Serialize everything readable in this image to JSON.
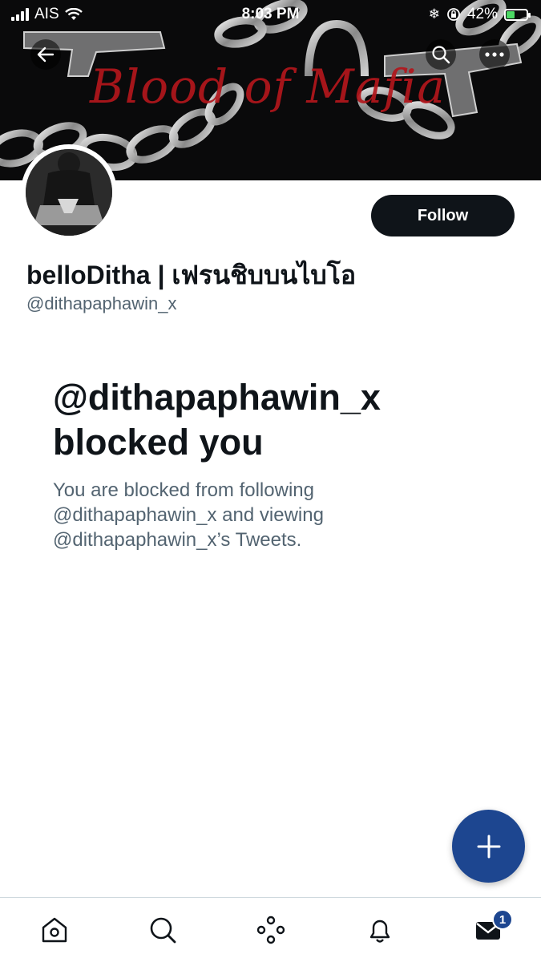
{
  "status_bar": {
    "carrier": "AIS",
    "time": "8:03 PM",
    "battery": "42%",
    "battery_level": 0.42
  },
  "top_nav": {
    "back_icon": "arrow-left-icon",
    "search_icon": "search-icon",
    "more_icon": "more-horizontal-icon"
  },
  "banner": {
    "text": "Blood of Mafia"
  },
  "profile": {
    "display_name": "belloDitha | เฟรนชิบบนไบโอ",
    "handle": "@dithapaphawin_x",
    "follow_label": "Follow"
  },
  "blocked": {
    "title_line1": "@dithapaphawin_x",
    "title_line2": "blocked you",
    "desc_line1": "You are blocked from following",
    "desc_line2": "@dithapaphawin_x and viewing",
    "desc_line3": "@dithapaphawin_x’s Tweets."
  },
  "fab": {
    "icon": "plus-icon"
  },
  "tabbar": {
    "items": [
      {
        "icon": "home-icon"
      },
      {
        "icon": "search-icon"
      },
      {
        "icon": "spaces-icon"
      },
      {
        "icon": "notifications-icon"
      },
      {
        "icon": "messages-icon",
        "badge": "1"
      }
    ]
  },
  "colors": {
    "accent": "#1d4690",
    "text_primary": "#0f1419",
    "text_secondary": "#536471",
    "banner_text": "#b3161c"
  }
}
